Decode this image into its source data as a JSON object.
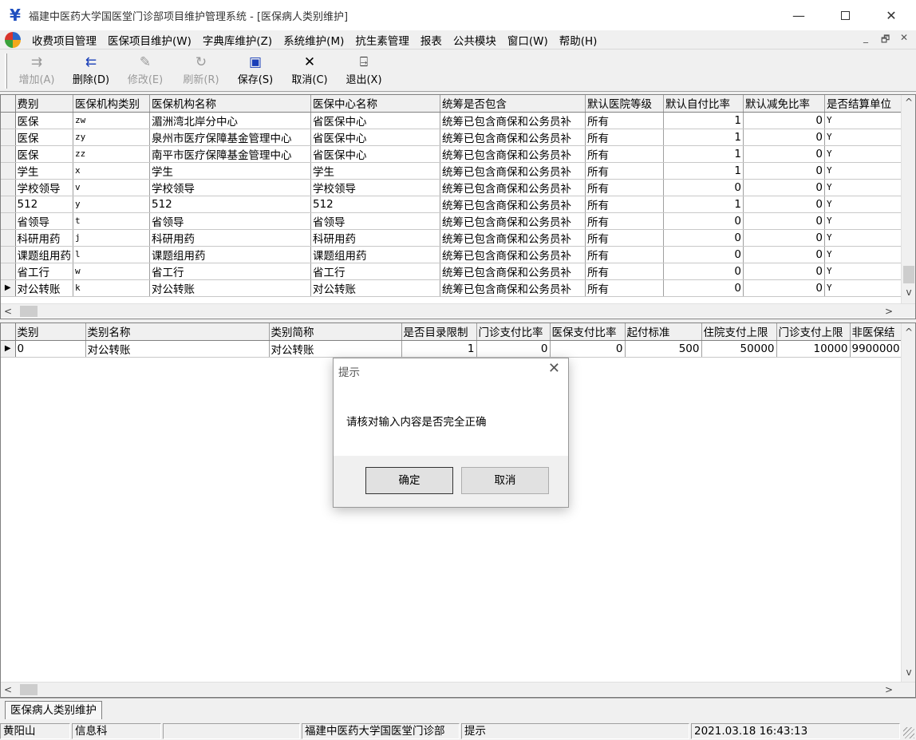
{
  "window": {
    "title": "福建中医药大学国医堂门诊部项目维护管理系统 - [医保病人类别维护]",
    "min_glyph": "—",
    "close_glyph": "✕"
  },
  "menu": {
    "items": [
      "收费项目管理",
      "医保项目维护(W)",
      "字典库维护(Z)",
      "系统维护(M)",
      "抗生素管理",
      "报表",
      "公共模块",
      "窗口(W)",
      "帮助(H)"
    ],
    "mdi_min": "_",
    "mdi_restore": "🗗",
    "mdi_close": "✕"
  },
  "toolbar": {
    "add_label": "增加(A)",
    "delete_label": "删除(D)",
    "edit_label": "修改(E)",
    "refresh_label": "刷新(R)",
    "save_label": "保存(S)",
    "cancel_label": "取消(C)",
    "exit_label": "退出(X)"
  },
  "grid1": {
    "columns": [
      "费别",
      "医保机构类别",
      "医保机构名称",
      "医保中心名称",
      "统筹是否包含",
      "默认医院等级",
      "默认自付比率",
      "默认减免比率",
      "是否结算单位",
      ""
    ],
    "rows": [
      [
        "医保",
        "zw",
        "湄洲湾北岸分中心",
        "省医保中心",
        "统筹已包含商保和公务员补",
        "所有",
        "1",
        "0",
        "Y",
        ""
      ],
      [
        "医保",
        "zy",
        "泉州市医疗保障基金管理中心",
        "省医保中心",
        "统筹已包含商保和公务员补",
        "所有",
        "1",
        "0",
        "Y",
        ""
      ],
      [
        "医保",
        "zz",
        "南平市医疗保障基金管理中心",
        "省医保中心",
        "统筹已包含商保和公务员补",
        "所有",
        "1",
        "0",
        "Y",
        ""
      ],
      [
        "学生",
        "x",
        "学生",
        "学生",
        "统筹已包含商保和公务员补",
        "所有",
        "1",
        "0",
        "Y",
        ""
      ],
      [
        "学校领导",
        "v",
        "学校领导",
        "学校领导",
        "统筹已包含商保和公务员补",
        "所有",
        "0",
        "0",
        "Y",
        ""
      ],
      [
        "512",
        "y",
        "512",
        "512",
        "统筹已包含商保和公务员补",
        "所有",
        "1",
        "0",
        "Y",
        ""
      ],
      [
        "省领导",
        "t",
        "省领导",
        "省领导",
        "统筹已包含商保和公务员补",
        "所有",
        "0",
        "0",
        "Y",
        ""
      ],
      [
        "科研用药",
        "j",
        "科研用药",
        "科研用药",
        "统筹已包含商保和公务员补",
        "所有",
        "0",
        "0",
        "Y",
        ""
      ],
      [
        "课题组用药",
        "l",
        "课题组用药",
        "课题组用药",
        "统筹已包含商保和公务员补",
        "所有",
        "0",
        "0",
        "Y",
        ""
      ],
      [
        "省工行",
        "w",
        "省工行",
        "省工行",
        "统筹已包含商保和公务员补",
        "所有",
        "0",
        "0",
        "Y",
        ""
      ],
      [
        "对公转账",
        "k",
        "对公转账",
        "对公转账",
        "统筹已包含商保和公务员补",
        "所有",
        "0",
        "0",
        "Y",
        ""
      ]
    ],
    "current_row": 10
  },
  "grid2": {
    "columns": [
      "类别",
      "类别名称",
      "类别简称",
      "是否目录限制",
      "门诊支付比率",
      "医保支付比率",
      "起付标准",
      "住院支付上限",
      "门诊支付上限",
      "非医保结"
    ],
    "rows": [
      [
        "0",
        "对公转账",
        "对公转账",
        "1",
        "0",
        "0",
        "500",
        "50000",
        "10000",
        "9900000"
      ]
    ],
    "current_row": 0
  },
  "tabs": [
    "医保病人类别维护"
  ],
  "status": {
    "user": "黄阳山",
    "dept": "信息科",
    "blank": "",
    "org": "福建中医药大学国医堂门诊部",
    "message": "提示",
    "datetime": "2021.03.18  16:43:13"
  },
  "dialog": {
    "title": "提示",
    "message": "请核对输入内容是否完全正确",
    "ok_label": "确定",
    "cancel_label": "取消",
    "close_glyph": "✕"
  },
  "glyphs": {
    "row_indicator": "▶",
    "arrow_left": "<",
    "arrow_right": ">",
    "arrow_up": "^",
    "arrow_down": "v"
  }
}
